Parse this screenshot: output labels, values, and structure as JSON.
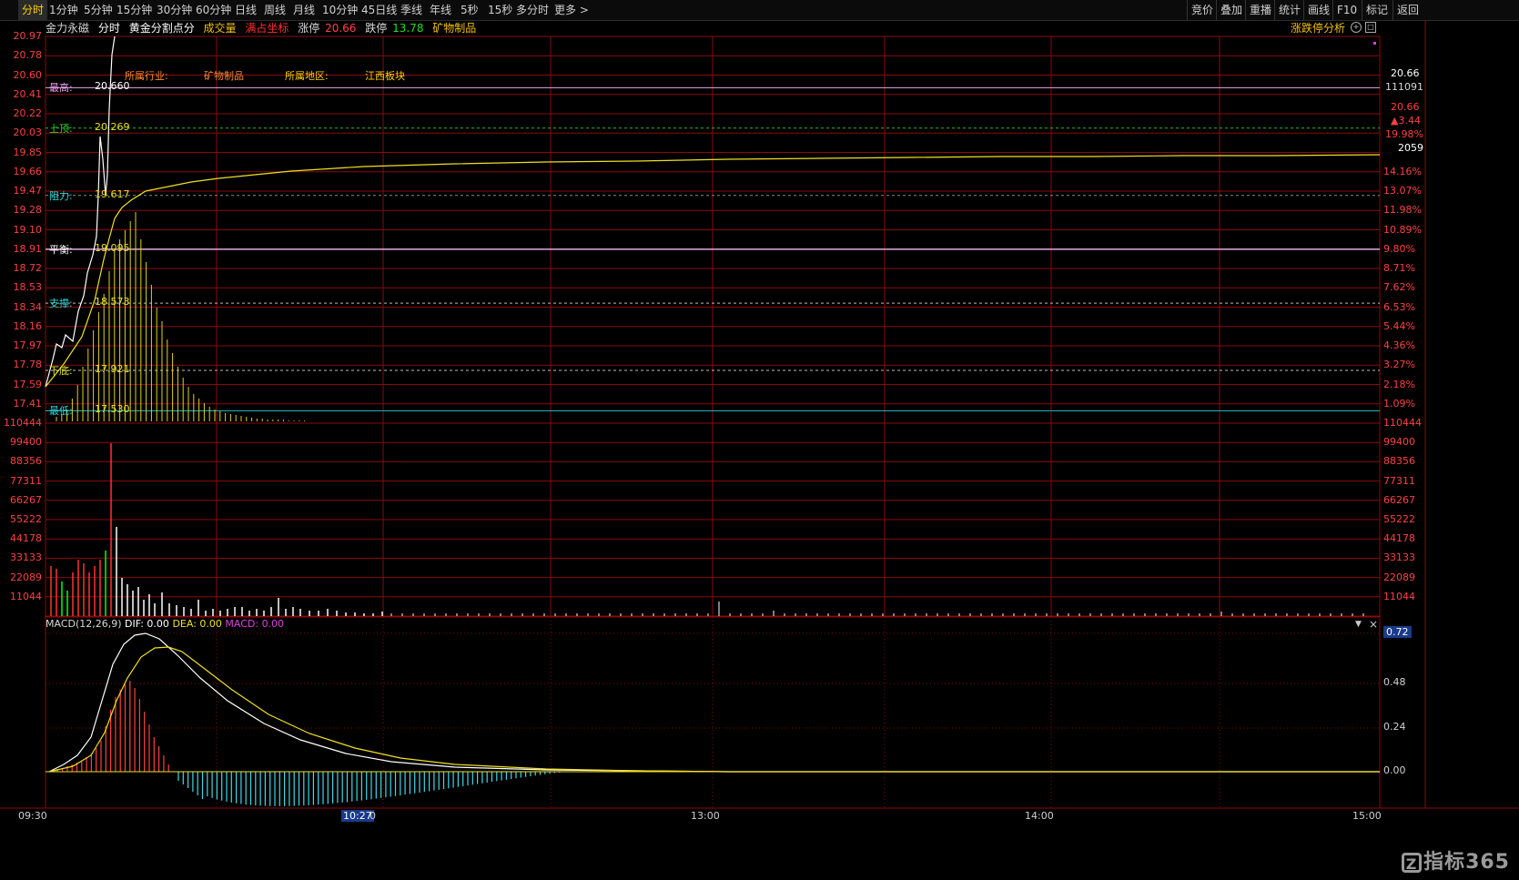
{
  "toolbar": {
    "periods": [
      "分时",
      "1分钟",
      "5分钟",
      "15分钟",
      "30分钟",
      "60分钟",
      "日线",
      "周线",
      "月线",
      "10分钟",
      "45日线",
      "季线",
      "年线",
      "5秒",
      "15秒",
      "多分时",
      "更多"
    ],
    "more_chevron": "chevron-right-icon",
    "right_buttons": [
      "竞价",
      "叠加",
      "重播",
      "统计",
      "画线",
      "F10",
      "标记",
      "返回"
    ]
  },
  "title": {
    "stock": "金力永磁",
    "mode": "分时",
    "indicator": "黄金分割点分",
    "volume_label": "成交量",
    "coord_label": "满占坐标",
    "limit_up_label": "涨停",
    "limit_up_value": "20.66",
    "limit_down_label": "跌停",
    "limit_down_value": "13.78",
    "sector": "矿物制品",
    "analysis_link": "涨跌停分析"
  },
  "info": {
    "industry_label": "所属行业:",
    "industry_value": "矿物制品",
    "region_label": "所属地区:",
    "region_value": "江西板块"
  },
  "price_axis_left": [
    "20.97",
    "20.78",
    "20.60",
    "20.41",
    "20.22",
    "20.03",
    "19.85",
    "19.66",
    "19.47",
    "19.28",
    "19.10",
    "18.91",
    "18.72",
    "18.53",
    "18.34",
    "18.16",
    "17.97",
    "17.78",
    "17.59",
    "17.41"
  ],
  "pct_axis_right": [
    "14.16%",
    "13.07%",
    "11.98%",
    "10.89%",
    "9.80%",
    "8.71%",
    "7.62%",
    "6.53%",
    "5.44%",
    "4.36%",
    "3.27%",
    "2.18%",
    "1.09%"
  ],
  "right_info": {
    "price": "20.66",
    "volume": "111091",
    "price2": "20.66",
    "change": "▲3.44",
    "change_pct": "19.98%",
    "hand": "2059"
  },
  "reference_lines": [
    {
      "label": "最高:",
      "value": "20.660",
      "color": "#e8a0e8"
    },
    {
      "label": "上顶:",
      "value": "20.269",
      "color": "#29d829"
    },
    {
      "label": "阻力:",
      "value": "19.617",
      "color": "#29d8d8"
    },
    {
      "label": "平衡:",
      "value": "19.095",
      "color": "#ffffff"
    },
    {
      "label": "支撑:",
      "value": "18.573",
      "color": "#29d8d8"
    },
    {
      "label": "下底:",
      "value": "17.921",
      "color": "#e0e020"
    },
    {
      "label": "最低:",
      "value": "17.530",
      "color": "#29d8d8"
    }
  ],
  "volume_axis": [
    "110444",
    "99400",
    "88356",
    "77311",
    "66267",
    "55222",
    "44178",
    "33133",
    "22089",
    "11044"
  ],
  "macd": {
    "title": "MACD(12,26,9)",
    "dif": "DIF: 0.00",
    "dea": "DEA: 0.00",
    "macd": "MACD: 0.00",
    "axis": [
      "0.72",
      "0.48",
      "0.24",
      "0.00"
    ]
  },
  "time_axis": [
    "09:30",
    "10:27",
    "0",
    "13:00",
    "14:00",
    "15:00"
  ],
  "logo_text": "指标365",
  "logo_icon": "zhibiao-logo-icon",
  "colors": {
    "grid": "#8a0a0a",
    "price_line": "#ffffff",
    "avg_line": "#f0e020",
    "up": "#ff3333",
    "down": "#00ff00",
    "macd_pos": "#ff4040",
    "macd_neg": "#40d8e8"
  }
}
